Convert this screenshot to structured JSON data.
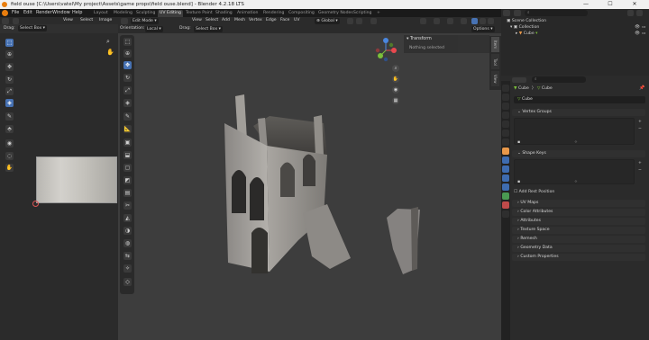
{
  "window": {
    "title": "field ouse [C:\\Users\\vatel\\My project\\Assets\\game props\\field ouse.blend] - Blender 4.2.18 LTS",
    "minimize": "—",
    "maximize": "☐",
    "close": "✕"
  },
  "menu": [
    "File",
    "Edit",
    "Render",
    "Window",
    "Help"
  ],
  "workspaces": [
    {
      "label": "Layout",
      "active": false
    },
    {
      "label": "Modeling",
      "active": false
    },
    {
      "label": "Sculpting",
      "active": false
    },
    {
      "label": "UV Editing",
      "active": true
    },
    {
      "label": "Texture Paint",
      "active": false
    },
    {
      "label": "Shading",
      "active": false
    },
    {
      "label": "Animation",
      "active": false
    },
    {
      "label": "Rendering",
      "active": false
    },
    {
      "label": "Compositing",
      "active": false
    },
    {
      "label": "Geometry Nodes",
      "active": false
    },
    {
      "label": "Scripting",
      "active": false
    }
  ],
  "scene": {
    "label": "Scene",
    "view_layer": "ViewLayer"
  },
  "uv_editor": {
    "menu": [
      "View",
      "Select",
      "Image"
    ],
    "drag_label": "Drag:",
    "select_box": "Select Box"
  },
  "viewport": {
    "mode": "Edit Mode",
    "menu": [
      "View",
      "Select",
      "Add",
      "Mesh",
      "Vertex",
      "Edge",
      "Face",
      "UV"
    ],
    "transform": "Global",
    "orientation_label": "Orientation:",
    "orientation": "Local",
    "drag_label": "Drag:",
    "select_box": "Select Box",
    "options": "Options",
    "sidebar_tabs": [
      "Item",
      "Tool",
      "View"
    ],
    "panel_title": "Transform",
    "panel_text": "Nothing selected"
  },
  "outliner": {
    "root": "Scene Collection",
    "collection": "Collection",
    "object": "Cube",
    "search_placeholder": ""
  },
  "properties": {
    "object_name": "Cube",
    "mesh_name": "Cube",
    "data_name": "Cube",
    "sections": {
      "vertex_groups": "Vertex Groups",
      "shape_keys": "Shape Keys",
      "add_rest_position": "Add Rest Position",
      "uv_maps": "UV Maps",
      "color_attributes": "Color Attributes",
      "attributes": "Attributes",
      "texture_space": "Texture Space",
      "remesh": "Remesh",
      "geometry_data": "Geometry Data",
      "custom_properties": "Custom Properties"
    }
  },
  "colors": {
    "accent": "#4772b3",
    "x_axis": "#e8484e",
    "y_axis": "#7bbf3a",
    "z_axis": "#4a87e0"
  }
}
